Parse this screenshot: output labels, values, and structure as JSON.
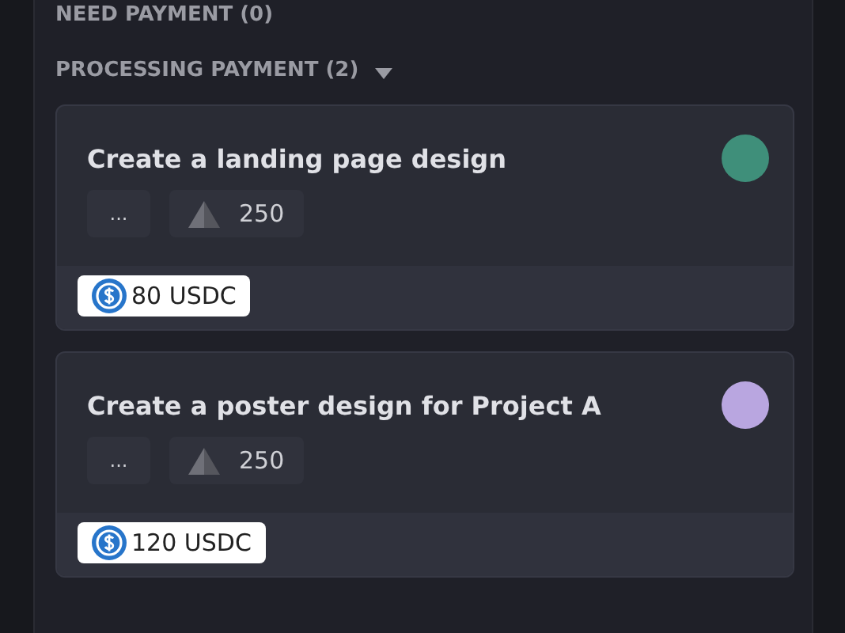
{
  "previous_section": {
    "title": "NEED PAYMENT (0)"
  },
  "section": {
    "title": "PROCESSING PAYMENT (2)",
    "expanded": true
  },
  "cards": [
    {
      "title": "Create a landing page design",
      "menu": "...",
      "points": "250",
      "reward": "80 USDC"
    },
    {
      "title": "Create a poster design for Project A",
      "menu": "...",
      "points": "250",
      "reward": "120 USDC"
    }
  ]
}
